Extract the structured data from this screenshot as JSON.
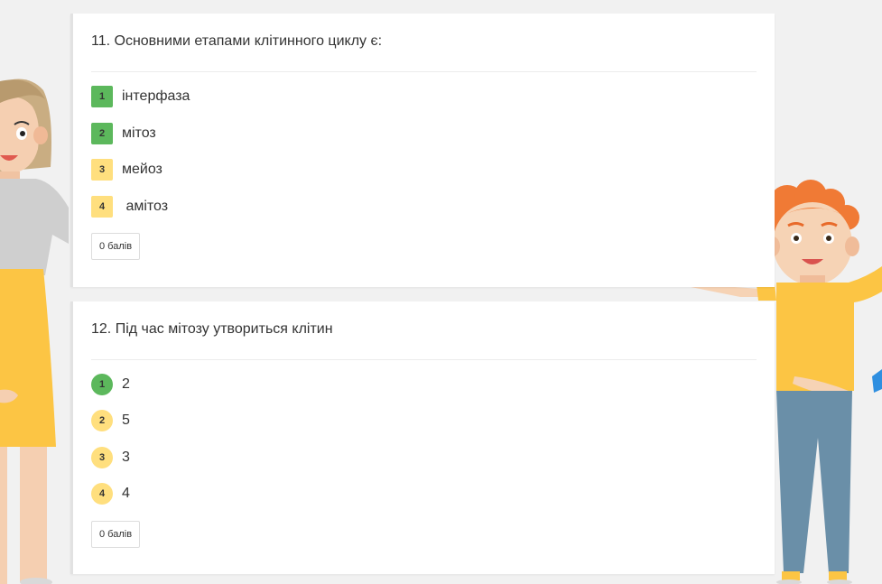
{
  "questions": [
    {
      "title": "11. Основними етапами клітинного циклу є:",
      "options": [
        {
          "num": "1",
          "text": "інтерфаза",
          "state": "correct"
        },
        {
          "num": "2",
          "text": "мітоз",
          "state": "correct"
        },
        {
          "num": "3",
          "text": "мейоз",
          "state": "neutral"
        },
        {
          "num": "4",
          "text": " амітоз",
          "state": "neutral"
        }
      ],
      "score_label": "0 балів"
    },
    {
      "title": "12. Під час мітозу утвориться клітин",
      "options": [
        {
          "num": "1",
          "text": "2",
          "state": "correct"
        },
        {
          "num": "2",
          "text": "5",
          "state": "neutral"
        },
        {
          "num": "3",
          "text": "3",
          "state": "neutral"
        },
        {
          "num": "4",
          "text": "4",
          "state": "neutral"
        }
      ],
      "score_label": "0 балів"
    }
  ],
  "colors": {
    "correct": "#5cb85c",
    "neutral": "#ffdf7e",
    "page_background": "#f1f1f1"
  },
  "illustrations": [
    "teacher-woman-illustration",
    "red-haired-boy-illustration"
  ]
}
